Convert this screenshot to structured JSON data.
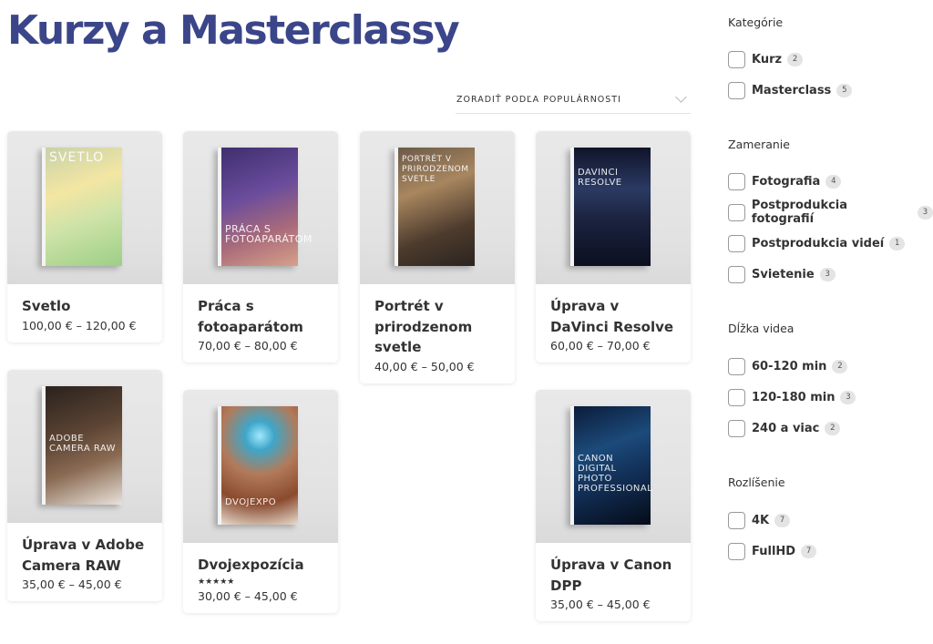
{
  "page": {
    "title": "Kurzy a Masterclassy"
  },
  "sort": {
    "label": "Zoradiť podľa populárnosti"
  },
  "products": [
    {
      "name": "Svetlo",
      "price": "100,00 € – 120,00 €",
      "cover_title": "Svetlo",
      "rating": ""
    },
    {
      "name": "Práca s fotoaparátom",
      "price": "70,00 € – 80,00 €",
      "cover_title": "Práca s fotoaparátom",
      "rating": ""
    },
    {
      "name": "Portrét v prirodzenom svetle",
      "price": "40,00 € – 50,00 €",
      "cover_title": "Portrét v prirodzenom svetle",
      "rating": ""
    },
    {
      "name": "Úprava v DaVinci Resolve",
      "price": "60,00 € – 70,00 €",
      "cover_title": "DaVinci Resolve",
      "rating": ""
    },
    {
      "name": "Úprava v Adobe Camera RAW",
      "price": "35,00 € – 45,00 €",
      "cover_title": "Adobe Camera RAW",
      "rating": ""
    },
    {
      "name": "Dvojexpozícia",
      "price": "30,00 € – 45,00 €",
      "cover_title": "Dvojexpo",
      "rating": "★★★★★"
    },
    {
      "name": "Úprava v Canon DPP",
      "price": "35,00 € – 45,00 €",
      "cover_title": "Canon Digital Photo Professional",
      "rating": ""
    }
  ],
  "filters": [
    {
      "title": "Kategórie",
      "items": [
        {
          "label": "Kurz",
          "count": "2"
        },
        {
          "label": "Masterclass",
          "count": "5"
        }
      ]
    },
    {
      "title": "Zameranie",
      "items": [
        {
          "label": "Fotografia",
          "count": "4"
        },
        {
          "label": "Postprodukcia fotografií",
          "count": "3"
        },
        {
          "label": "Postprodukcia videí",
          "count": "1"
        },
        {
          "label": "Svietenie",
          "count": "3"
        }
      ]
    },
    {
      "title": "Dĺžka videa",
      "items": [
        {
          "label": "60-120 min",
          "count": "2"
        },
        {
          "label": "120-180 min",
          "count": "3"
        },
        {
          "label": "240 a viac",
          "count": "2"
        }
      ]
    },
    {
      "title": "Rozlíšenie",
      "items": [
        {
          "label": "4K",
          "count": "7"
        },
        {
          "label": "FullHD",
          "count": "7"
        }
      ]
    }
  ],
  "colors": {
    "title": "#3b4589",
    "text": "#333333",
    "badge": "#e4e4e4"
  }
}
